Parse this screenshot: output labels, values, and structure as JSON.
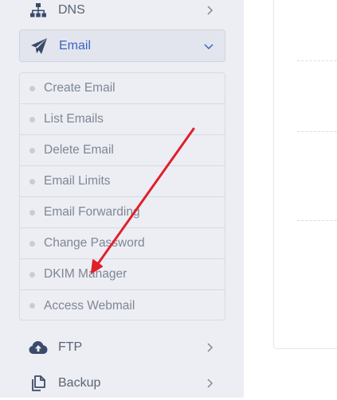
{
  "sidebar": {
    "dns": {
      "label": "DNS",
      "icon": "sitemap-icon"
    },
    "email": {
      "label": "Email",
      "icon": "paper-plane-icon",
      "expanded": true
    },
    "email_submenu": [
      {
        "label": "Create Email"
      },
      {
        "label": "List Emails"
      },
      {
        "label": "Delete Email"
      },
      {
        "label": "Email Limits"
      },
      {
        "label": "Email Forwarding"
      },
      {
        "label": "Change Password"
      },
      {
        "label": "DKIM Manager"
      },
      {
        "label": "Access Webmail"
      }
    ],
    "ftp": {
      "label": "FTP",
      "icon": "cloud-upload-icon"
    },
    "backup": {
      "label": "Backup",
      "icon": "copy-icon"
    }
  },
  "colors": {
    "sidebar_bg": "#eceef3",
    "active_text": "#3b63c7",
    "annotation_arrow": "#e0202a"
  },
  "annotation": {
    "type": "arrow",
    "points_to": "DKIM Manager"
  }
}
